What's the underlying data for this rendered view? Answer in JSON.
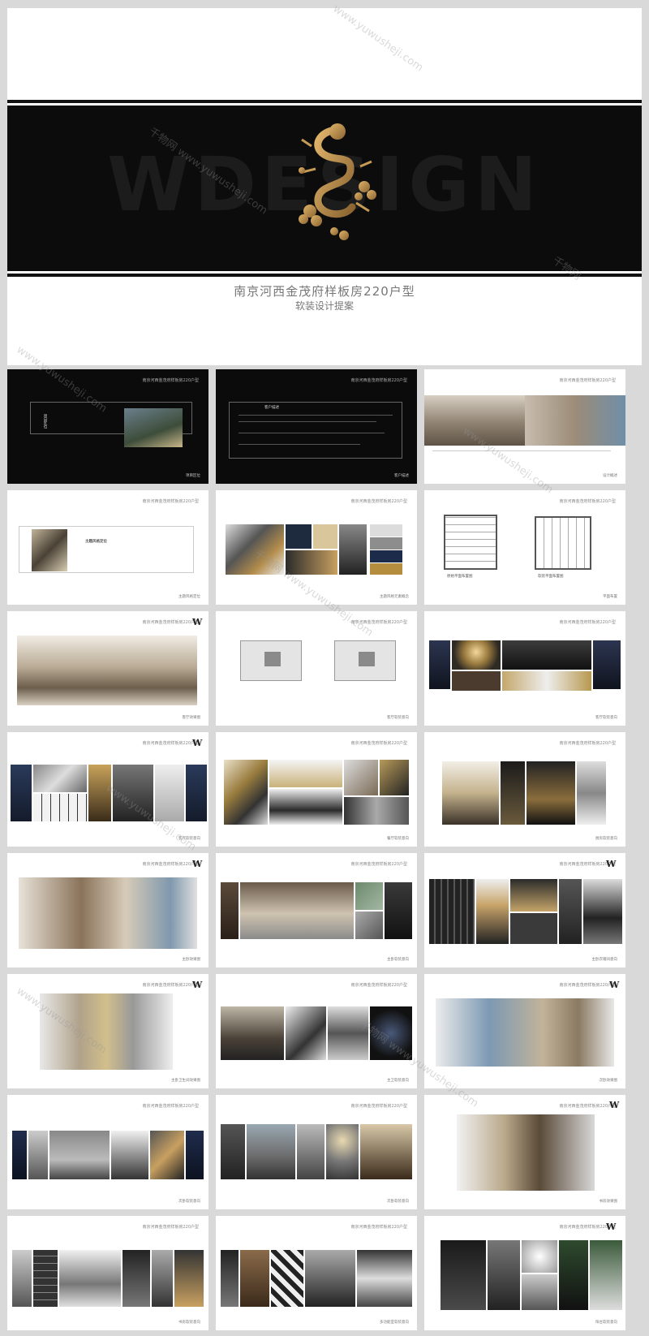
{
  "cover": {
    "ghost_word": "WDESIGN",
    "title": "南京河西金茂府样板房220户型",
    "subtitle": "软装设计提案",
    "colors": {
      "band": "#0c0c0c",
      "gold": "#b8894a"
    }
  },
  "pages": [
    {
      "header": "南京河西金茂府样板房220户型",
      "footer": "项目区位",
      "vertical_text": "项目区位",
      "dark": true
    },
    {
      "header": "南京河西金茂府样板房220户型",
      "footer": "客户描述",
      "box_title": "客户描述",
      "dark": true
    },
    {
      "header": "南京河西金茂府样板房220户型",
      "footer": "设计概述",
      "dark": false
    },
    {
      "header": "南京河西金茂府样板房220户型",
      "footer": "主题风格定位",
      "box_title": "主题风格定位",
      "dark": false
    },
    {
      "header": "南京河西金茂府样板房220户型",
      "footer": "主题风格元素概念",
      "dark": false
    },
    {
      "header": "南京河西金茂府样板房220户型",
      "footer": "平面布置",
      "plan_labels": [
        "原始平面布置图",
        "软装平面布置图"
      ],
      "dark": false
    },
    {
      "header": "南京河西金茂府样板房220户型",
      "footer": "客厅效果图",
      "logo": "W",
      "dark": false
    },
    {
      "header": "南京河西金茂府样板房220户型",
      "footer": "客厅软装意向",
      "dark": false
    },
    {
      "header": "南京河西金茂府样板房220户型",
      "footer": "客厅软装意向",
      "dark": false
    },
    {
      "header": "南京河西金茂府样板房220户型",
      "footer": "客厅软装意向",
      "logo": "W",
      "dark": false
    },
    {
      "header": "南京河西金茂府样板房220户型",
      "footer": "餐厅软装意向",
      "dark": false
    },
    {
      "header": "南京河西金茂府样板房220户型",
      "footer": "厨房软装意向",
      "dark": false
    },
    {
      "header": "南京河西金茂府样板房220户型",
      "footer": "主卧效果图",
      "logo": "W",
      "dark": false
    },
    {
      "header": "南京河西金茂府样板房220户型",
      "footer": "主卧软装意向",
      "dark": false
    },
    {
      "header": "南京河西金茂府样板房220户型",
      "footer": "主卧衣帽间意向",
      "logo": "W",
      "dark": false
    },
    {
      "header": "南京河西金茂府样板房220户型",
      "footer": "主卧卫生间效果图",
      "logo": "W",
      "dark": false
    },
    {
      "header": "南京河西金茂府样板房220户型",
      "footer": "主卫软装意向",
      "dark": false
    },
    {
      "header": "南京河西金茂府样板房220户型",
      "footer": "次卧效果图",
      "logo": "W",
      "dark": false
    },
    {
      "header": "南京河西金茂府样板房220户型",
      "footer": "次卧软装意向",
      "dark": false
    },
    {
      "header": "南京河西金茂府样板房220户型",
      "footer": "次卧软装意向",
      "dark": false
    },
    {
      "header": "南京河西金茂府样板房220户型",
      "footer": "书房效果图",
      "logo": "W",
      "dark": false
    },
    {
      "header": "南京河西金茂府样板房220户型",
      "footer": "书房软装意向",
      "dark": false
    },
    {
      "header": "南京河西金茂府样板房220户型",
      "footer": "多功能室软装意向",
      "dark": false
    },
    {
      "header": "南京河西金茂府样板房220户型",
      "footer": "阳台软装意向",
      "logo": "W",
      "dark": false
    }
  ],
  "watermarks": [
    "www.yuwusheji.com",
    "千物网 www.yuwusheji.com",
    "千物网"
  ]
}
